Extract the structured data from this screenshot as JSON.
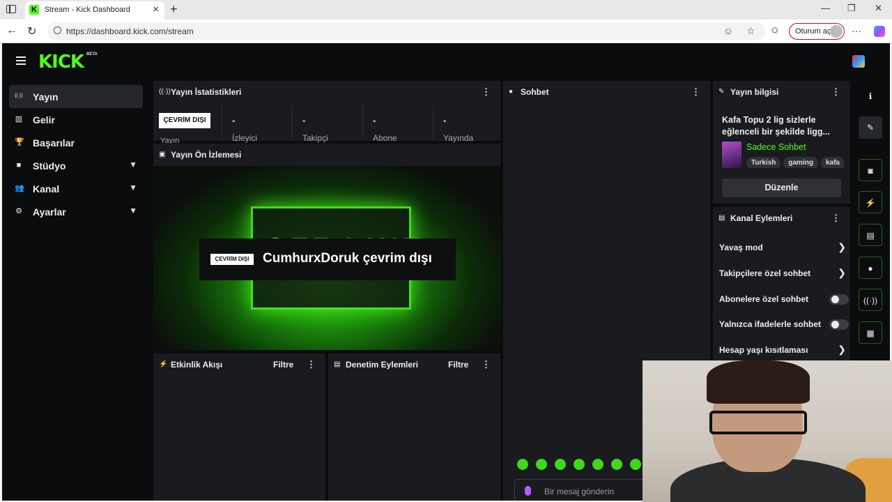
{
  "browser": {
    "tab_title": "Stream - Kick Dashboard",
    "favicon_letter": "K",
    "url": "https://dashboard.kick.com/stream",
    "signin_label": "Oturum aç"
  },
  "app": {
    "logo": "KICK",
    "beta": "BETA"
  },
  "sidebar": {
    "items": [
      {
        "label": "Yayın",
        "icon": "broadcast-icon",
        "glyph": "((·))",
        "active": true,
        "expandable": false
      },
      {
        "label": "Gelir",
        "icon": "chart-icon",
        "glyph": "▥",
        "active": false,
        "expandable": false
      },
      {
        "label": "Başarılar",
        "icon": "trophy-icon",
        "glyph": "🏆",
        "active": false,
        "expandable": false
      },
      {
        "label": "Stüdyo",
        "icon": "video-icon",
        "glyph": "■",
        "active": false,
        "expandable": true
      },
      {
        "label": "Kanal",
        "icon": "users-icon",
        "glyph": "👥",
        "active": false,
        "expandable": true
      },
      {
        "label": "Ayarlar",
        "icon": "gear-icon",
        "glyph": "⚙",
        "active": false,
        "expandable": true
      }
    ]
  },
  "stats": {
    "title": "Yayın İstatistikleri",
    "status_badge": "ÇEVRİM DIŞI",
    "status_sublabel": "Yayın",
    "cells": [
      {
        "value": "-",
        "label": "İzleyici"
      },
      {
        "value": "-",
        "label": "Takipçi"
      },
      {
        "value": "-",
        "label": "Abone"
      },
      {
        "value": "-",
        "label": "Yayında"
      }
    ]
  },
  "preview": {
    "title": "Yayın Ön İzlemesi",
    "offline_badge": "ÇEVRİM DIŞI",
    "offline_text": "CumhurxDoruk çevrim dışı",
    "art_text": "OFF LINE"
  },
  "activity": {
    "title": "Etkinlik Akışı",
    "filter": "Filtre"
  },
  "moderation": {
    "title": "Denetim Eylemleri",
    "filter": "Filtre"
  },
  "chat": {
    "title": "Sohbet",
    "placeholder": "Bir mesaj gönderin"
  },
  "stream_info": {
    "title": "Yayın bilgisi",
    "stream_title": "Kafa Topu 2 lig sizlerle eğlenceli bir şekilde ligg...",
    "category": "Sadece Sohbet",
    "tags": [
      "Turkish",
      "gaming",
      "kafa"
    ],
    "edit_label": "Düzenle"
  },
  "channel_actions": {
    "title": "Kanal Eylemleri",
    "items": [
      {
        "label": "Yavaş mod",
        "control": "chevron"
      },
      {
        "label": "Takipçilere özel sohbet",
        "control": "chevron"
      },
      {
        "label": "Abonelere özel sohbet",
        "control": "toggle",
        "on": false
      },
      {
        "label": "Yalnızca ifadelerle sohbet",
        "control": "toggle",
        "on": false
      },
      {
        "label": "Hesap yaşı kısıtlaması",
        "control": "chevron"
      }
    ]
  },
  "rail_icons": [
    "info-icon",
    "pencil-icon",
    "camera-icon",
    "bolt-icon",
    "note-icon",
    "chat-icon",
    "broadcast-icon",
    "layout-icon"
  ],
  "colors": {
    "accent": "#53fc18",
    "panel": "#191b1f",
    "background": "#0b0c0d"
  }
}
